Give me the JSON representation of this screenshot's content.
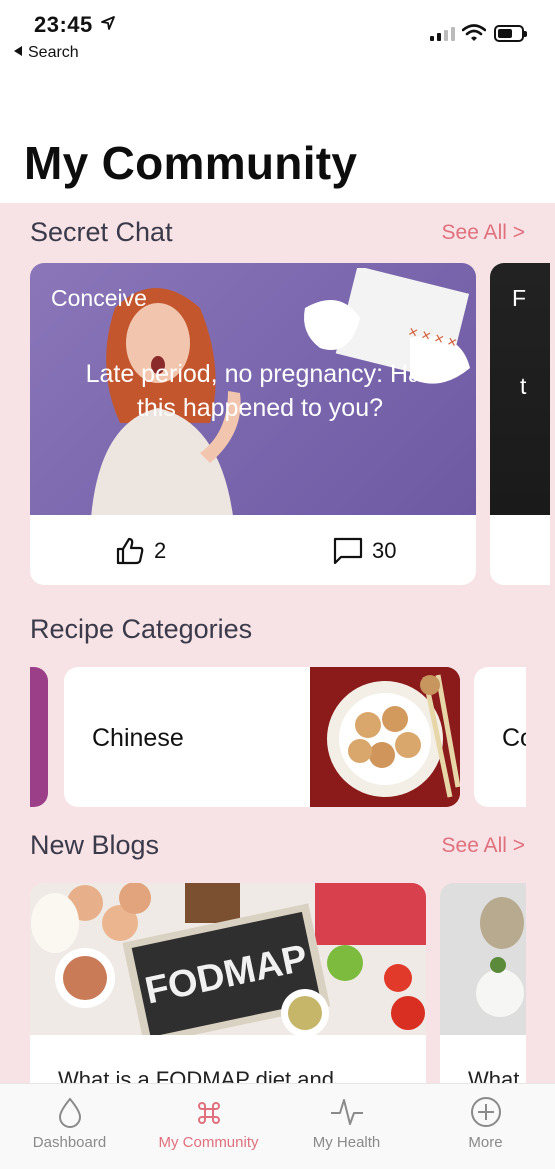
{
  "status_bar": {
    "time": "23:45",
    "back_label": "Search",
    "icons": [
      "location-arrow-icon",
      "cellular-signal-icon",
      "wifi-icon",
      "battery-icon"
    ]
  },
  "page": {
    "title": "My Community"
  },
  "secret_chat": {
    "title": "Secret Chat",
    "see_all": "See All >",
    "cards": [
      {
        "tag": "Conceive",
        "headline": "Late period, no pregnancy: Has this happened to you?",
        "likes": "2",
        "comments": "30"
      },
      {
        "tag": "F",
        "headline_fragment": "t"
      }
    ]
  },
  "recipes": {
    "title": "Recipe Categories",
    "items": [
      {
        "name": "Chinese"
      },
      {
        "name": "Co"
      }
    ]
  },
  "blogs": {
    "title": "New Blogs",
    "see_all": "See All >",
    "items": [
      {
        "title": "What is a FODMAP diet and",
        "image_text": "FODMAP"
      },
      {
        "title": "What"
      }
    ]
  },
  "tab_bar": {
    "tabs": [
      {
        "label": "Dashboard",
        "icon": "drop-icon",
        "active": false
      },
      {
        "label": "My Community",
        "icon": "command-icon",
        "active": true
      },
      {
        "label": "My Health",
        "icon": "pulse-icon",
        "active": false
      },
      {
        "label": "More",
        "icon": "plus-circle-icon",
        "active": false
      }
    ]
  },
  "colors": {
    "accent": "#e0707e",
    "background_pink": "#f7e3e5",
    "chat_image": "#7a66ad"
  }
}
